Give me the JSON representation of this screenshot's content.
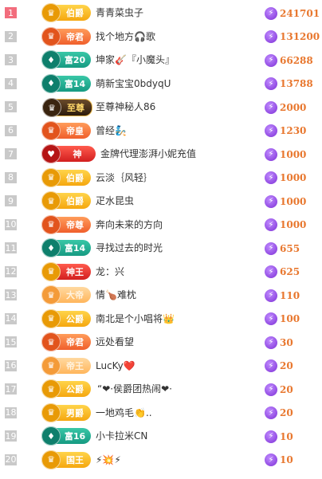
{
  "rows": [
    {
      "rank": "1",
      "badge": "伯爵",
      "name": "青青菜虫子",
      "value": "241701"
    },
    {
      "rank": "2",
      "badge": "帝君",
      "name": "找个地方🎧歌",
      "value": "131200"
    },
    {
      "rank": "3",
      "badge": "富20",
      "name": "坤家🎸『小魔头』",
      "value": "66288"
    },
    {
      "rank": "4",
      "badge": "富14",
      "name": "萌新宝宝0bdyqU",
      "value": "13788"
    },
    {
      "rank": "5",
      "badge": "至尊",
      "name": "至尊神秘人86",
      "value": "2000"
    },
    {
      "rank": "6",
      "badge": "帝皇",
      "name": "曾经🧞",
      "value": "1230"
    },
    {
      "rank": "7",
      "badge": "神",
      "name": "金牌代理澎湃小妮充值",
      "value": "1000"
    },
    {
      "rank": "8",
      "badge": "伯爵",
      "name": "云淡｛风轻｝",
      "value": "1000"
    },
    {
      "rank": "9",
      "badge": "伯爵",
      "name": "疋水昆虫",
      "value": "1000"
    },
    {
      "rank": "10",
      "badge": "帝尊",
      "name": "奔向未来的方向",
      "value": "1000"
    },
    {
      "rank": "11",
      "badge": "富14",
      "name": "寻找过去的时光",
      "value": "655"
    },
    {
      "rank": "12",
      "badge": "神王",
      "name": "龙：兴",
      "value": "625"
    },
    {
      "rank": "13",
      "badge": "大帝",
      "name": "情🍗难枕",
      "value": "110"
    },
    {
      "rank": "14",
      "badge": "公爵",
      "name": "南北是个小唱将👑",
      "value": "100"
    },
    {
      "rank": "15",
      "badge": "帝君",
      "name": "远处看望",
      "value": "30"
    },
    {
      "rank": "16",
      "badge": "帝王",
      "name": "LucKy❤️",
      "value": "20"
    },
    {
      "rank": "17",
      "badge": "公爵",
      "name": "“❤·侯爵团热闹❤·",
      "value": "20"
    },
    {
      "rank": "18",
      "badge": "男爵",
      "name": "一地鸡毛👏..",
      "value": "20"
    },
    {
      "rank": "19",
      "badge": "富16",
      "name": "小卡拉米CN",
      "value": "10"
    },
    {
      "rank": "20",
      "badge": "国王",
      "name": "⚡💥⚡",
      "value": "10"
    }
  ],
  "colors": {
    "accent": "#e8772e",
    "top_rank": "#f26d7d",
    "rank": "#c9c9c9",
    "currency": "#7d2fd6"
  },
  "icons": {
    "currency": "lightning-coin-icon"
  }
}
